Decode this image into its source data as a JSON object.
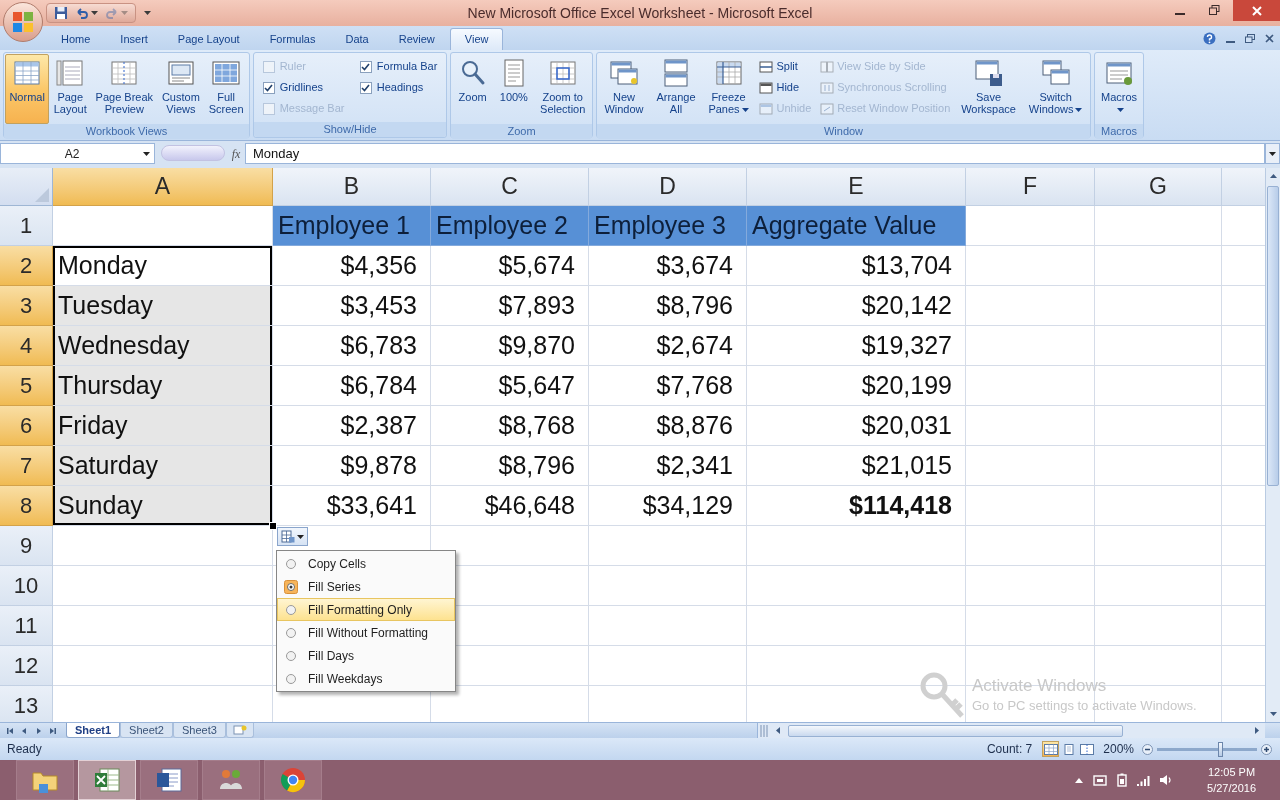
{
  "window": {
    "title": "New Microsoft Office Excel Worksheet - Microsoft Excel"
  },
  "quick_access": [
    {
      "disabled": false
    },
    {
      "disabled": false
    },
    {
      "disabled": true
    }
  ],
  "ribbon": {
    "tabs": [
      {
        "label": "Home",
        "selected": false
      },
      {
        "label": "Insert",
        "selected": false
      },
      {
        "label": "Page Layout",
        "selected": false
      },
      {
        "label": "Formulas",
        "selected": false
      },
      {
        "label": "Data",
        "selected": false
      },
      {
        "label": "Review",
        "selected": false
      },
      {
        "label": "View",
        "selected": true
      }
    ],
    "groups": [
      {
        "label": "Workbook Views",
        "items": [
          {
            "kind": "large",
            "label": "Normal",
            "selected": true
          },
          {
            "kind": "large",
            "label": "Page\nLayout",
            "selected": false
          },
          {
            "kind": "large",
            "label": "Page Break\nPreview",
            "selected": false
          },
          {
            "kind": "large",
            "label": "Custom\nViews",
            "selected": false
          },
          {
            "kind": "large",
            "label": "Full\nScreen",
            "selected": false
          }
        ]
      },
      {
        "label": "Show/Hide",
        "items": [
          {
            "kind": "checkbox",
            "label": "Ruler",
            "checked": false,
            "disabled": true
          },
          {
            "kind": "checkbox",
            "label": "Gridlines",
            "checked": true,
            "disabled": false
          },
          {
            "kind": "checkbox",
            "label": "Message Bar",
            "checked": false,
            "disabled": true
          },
          {
            "kind": "checkbox",
            "label": "Formula Bar",
            "checked": true,
            "disabled": false
          },
          {
            "kind": "checkbox",
            "label": "Headings",
            "checked": true,
            "disabled": false
          }
        ]
      },
      {
        "label": "Zoom",
        "items": [
          {
            "kind": "large",
            "label": "Zoom"
          },
          {
            "kind": "large",
            "label": "100%"
          },
          {
            "kind": "large",
            "label": "Zoom to\nSelection"
          }
        ]
      },
      {
        "label": "Window",
        "items": [
          {
            "kind": "large",
            "label": "New\nWindow"
          },
          {
            "kind": "large",
            "label": "Arrange\nAll"
          },
          {
            "kind": "large",
            "label": "Freeze\nPanes",
            "dropdown": true
          },
          {
            "kind": "small",
            "label": "Split",
            "disabled": false
          },
          {
            "kind": "small",
            "label": "Hide",
            "disabled": false
          },
          {
            "kind": "small",
            "label": "Unhide",
            "disabled": true
          },
          {
            "kind": "small",
            "label": "View Side by Side",
            "disabled": true
          },
          {
            "kind": "small",
            "label": "Synchronous Scrolling",
            "disabled": true
          },
          {
            "kind": "small",
            "label": "Reset Window Position",
            "disabled": true
          },
          {
            "kind": "large",
            "label": "Save\nWorkspace"
          },
          {
            "kind": "large",
            "label": "Switch\nWindows",
            "dropdown": true
          }
        ]
      },
      {
        "label": "Macros",
        "items": [
          {
            "kind": "large",
            "label": "Macros",
            "dropdown": true
          }
        ]
      }
    ]
  },
  "formula_bar": {
    "name_box": "A2",
    "function_button": "fx",
    "formula": "Monday"
  },
  "sheet": {
    "columns": [
      {
        "label": "A",
        "selected": true
      },
      {
        "label": "B",
        "selected": false
      },
      {
        "label": "C",
        "selected": false
      },
      {
        "label": "D",
        "selected": false
      },
      {
        "label": "E",
        "selected": false
      },
      {
        "label": "F",
        "selected": false
      },
      {
        "label": "G",
        "selected": false
      }
    ],
    "rows": [
      {
        "kind": "header",
        "number": "1",
        "selected": false,
        "labels": [
          "Employee 1",
          "Employee 2",
          "Employee 3",
          "Aggregate Value"
        ]
      },
      {
        "kind": "data",
        "number": "2",
        "selected": true,
        "active": true,
        "label": "Monday",
        "values": [
          {
            "text": "$4,356",
            "bold": false
          },
          {
            "text": "$5,674",
            "bold": false
          },
          {
            "text": "$3,674",
            "bold": false
          },
          {
            "text": "$13,704",
            "bold": false
          }
        ]
      },
      {
        "kind": "data",
        "number": "3",
        "selected": true,
        "active": false,
        "label": "Tuesday",
        "values": [
          {
            "text": "$3,453",
            "bold": false
          },
          {
            "text": "$7,893",
            "bold": false
          },
          {
            "text": "$8,796",
            "bold": false
          },
          {
            "text": "$20,142",
            "bold": false
          }
        ]
      },
      {
        "kind": "data",
        "number": "4",
        "selected": true,
        "active": false,
        "label": "Wednesday",
        "values": [
          {
            "text": "$6,783",
            "bold": false
          },
          {
            "text": "$9,870",
            "bold": false
          },
          {
            "text": "$2,674",
            "bold": false
          },
          {
            "text": "$19,327",
            "bold": false
          }
        ]
      },
      {
        "kind": "data",
        "number": "5",
        "selected": true,
        "active": false,
        "label": "Thursday",
        "values": [
          {
            "text": "$6,784",
            "bold": false
          },
          {
            "text": "$5,647",
            "bold": false
          },
          {
            "text": "$7,768",
            "bold": false
          },
          {
            "text": "$20,199",
            "bold": false
          }
        ]
      },
      {
        "kind": "data",
        "number": "6",
        "selected": true,
        "active": false,
        "label": "Friday",
        "values": [
          {
            "text": "$2,387",
            "bold": false
          },
          {
            "text": "$8,768",
            "bold": false
          },
          {
            "text": "$8,876",
            "bold": false
          },
          {
            "text": "$20,031",
            "bold": false
          }
        ]
      },
      {
        "kind": "data",
        "number": "7",
        "selected": true,
        "active": false,
        "label": "Saturday",
        "values": [
          {
            "text": "$9,878",
            "bold": false
          },
          {
            "text": "$8,796",
            "bold": false
          },
          {
            "text": "$2,341",
            "bold": false
          },
          {
            "text": "$21,015",
            "bold": false
          }
        ]
      },
      {
        "kind": "data",
        "number": "8",
        "selected": true,
        "active": false,
        "label": "Sunday",
        "values": [
          {
            "text": "$33,641",
            "bold": false
          },
          {
            "text": "$46,648",
            "bold": false
          },
          {
            "text": "$34,129",
            "bold": false
          },
          {
            "text": "$114,418",
            "bold": true
          }
        ]
      },
      {
        "kind": "empty",
        "number": "9",
        "selected": false
      },
      {
        "kind": "empty",
        "number": "10",
        "selected": false
      },
      {
        "kind": "empty",
        "number": "11",
        "selected": false
      },
      {
        "kind": "empty",
        "number": "12",
        "selected": false
      },
      {
        "kind": "empty",
        "number": "13",
        "selected": false
      }
    ]
  },
  "paste_options": {
    "items": [
      {
        "label": "Copy Cells",
        "selected": false,
        "highlighted": false
      },
      {
        "label": "Fill Series",
        "selected": true,
        "highlighted": false
      },
      {
        "label": "Fill Formatting Only",
        "selected": false,
        "highlighted": true
      },
      {
        "label": "Fill Without Formatting",
        "selected": false,
        "highlighted": false
      },
      {
        "label": "Fill Days",
        "selected": false,
        "highlighted": false
      },
      {
        "label": "Fill Weekdays",
        "selected": false,
        "highlighted": false
      }
    ]
  },
  "activation_notice": {
    "title": "Activate Windows",
    "message": "Go to PC settings to activate Windows."
  },
  "sheet_tabs": [
    {
      "label": "Sheet1",
      "selected": true
    },
    {
      "label": "Sheet2",
      "selected": false
    },
    {
      "label": "Sheet3",
      "selected": false
    }
  ],
  "status_bar": {
    "status": "Ready",
    "count": "Count: 7",
    "view_buttons": [
      {
        "selected": true
      },
      {
        "selected": false
      },
      {
        "selected": false
      }
    ],
    "zoom": "200%",
    "zoom_slider": {
      "level": 0.63
    }
  },
  "taskbar": {
    "apps": [
      {
        "active": false
      },
      {
        "active": true
      },
      {
        "active": false
      },
      {
        "active": false
      },
      {
        "active": false
      }
    ],
    "time": "12:05 PM",
    "date": "5/27/2016"
  }
}
